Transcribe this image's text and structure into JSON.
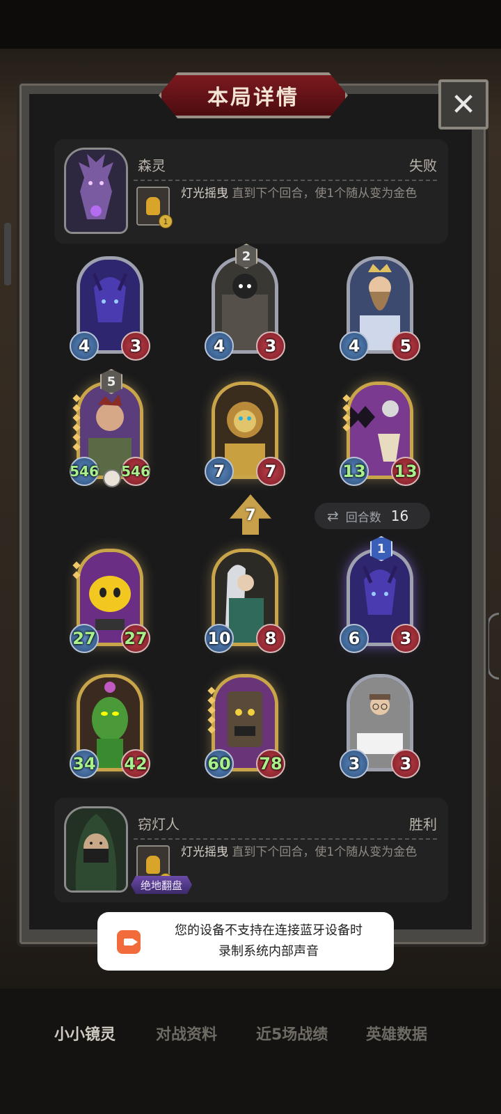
{
  "header": {
    "title": "本局详情",
    "close_glyph": "✕"
  },
  "opponent": {
    "name": "森灵",
    "result": "失败",
    "hero_power": {
      "name": "灯光摇曳",
      "cost": "1",
      "desc": "直到下个回合，使1个随从变为金色"
    },
    "portrait_icon": "purple-dragon-portrait"
  },
  "player": {
    "name": "窃灯人",
    "result": "胜利",
    "hero_power": {
      "name": "灯光摇曳",
      "cost": "1",
      "desc": "直到下个回合，使1个随从变为金色"
    },
    "badge": "绝地翻盘",
    "portrait_icon": "hooded-thief-portrait"
  },
  "opponent_board": [
    {
      "atk": "4",
      "hp": "3",
      "art": "purple-stag",
      "style": "silver"
    },
    {
      "atk": "4",
      "hp": "3",
      "art": "armored-knight",
      "style": "silver",
      "tier": "2"
    },
    {
      "atk": "4",
      "hp": "5",
      "art": "bearded-king",
      "style": "silver"
    },
    {
      "atk": "546",
      "hp": "546",
      "art": "scarred-brute",
      "style": "gold",
      "tier": "5",
      "buffed": true
    },
    {
      "atk": "7",
      "hp": "7",
      "art": "golden-lion",
      "style": "gold"
    },
    {
      "atk": "13",
      "hp": "13",
      "art": "harlequin-knight",
      "style": "gold",
      "buffed": true
    }
  ],
  "player_board": [
    {
      "atk": "27",
      "hp": "27",
      "art": "golden-slime",
      "style": "gold",
      "buffed": true
    },
    {
      "atk": "10",
      "hp": "8",
      "art": "priestess",
      "style": "gold"
    },
    {
      "atk": "6",
      "hp": "3",
      "art": "purple-stag",
      "style": "silver",
      "tier": "1"
    },
    {
      "atk": "34",
      "hp": "42",
      "art": "cactus",
      "style": "gold",
      "buffed": true
    },
    {
      "atk": "60",
      "hp": "78",
      "art": "tiki-mask",
      "style": "gold",
      "buffed": true
    },
    {
      "atk": "3",
      "hp": "3",
      "art": "scribe",
      "style": "silver"
    }
  ],
  "tavern_tier": "7",
  "round": {
    "label": "回合数",
    "value": "16",
    "icon": "repeat-icon"
  },
  "toast": {
    "line1": "您的设备不支持在连接蓝牙设备时",
    "line2": "录制系统内部声音",
    "icon": "record-icon"
  },
  "tabs": [
    "小小镜灵",
    "对战资料",
    "近5场战绩",
    "英雄数据"
  ],
  "colors": {
    "gold_frame": "#c9a54a",
    "silver_frame": "#9ea1ae",
    "attack": "#2c4e7a",
    "health": "#7a1c24",
    "buff_text": "#a8f08a",
    "title_banner": "#7a1a1e"
  }
}
